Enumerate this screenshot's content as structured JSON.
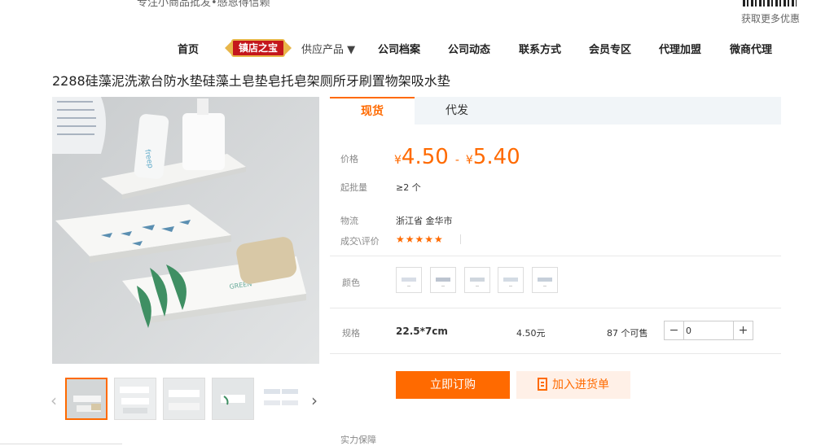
{
  "header": {
    "slogan": "专注小商品批发•感恩得信赖",
    "qr_text": "获取更多优惠"
  },
  "nav": {
    "home": "首页",
    "badge": "镇店之宝",
    "supply": "供应产品 ▼",
    "profile": "公司档案",
    "news": "公司动态",
    "contact": "联系方式",
    "member": "会员专区",
    "agent": "代理加盟",
    "micro": "微商代理"
  },
  "product": {
    "title": "2288硅藻泥洗漱台防水垫硅藻土皂垫皂托皂架厕所牙刷置物架吸水垫"
  },
  "tabs": [
    "现货",
    "代发"
  ],
  "price": {
    "label": "价格",
    "currency": "¥",
    "min": "4.50",
    "sep": "-",
    "max": "5.40"
  },
  "moq": {
    "label": "起批量",
    "value": "≥2 个"
  },
  "logistics": {
    "label": "物流",
    "value": "浙江省 金华市"
  },
  "reviews": {
    "label": "成交\\评价",
    "stars": "★★★★★",
    "rating": 5
  },
  "color": {
    "label": "颜色",
    "swatch_count": 5
  },
  "spec": {
    "label": "规格",
    "size": "22.5*7cm",
    "price": "4.50元",
    "stock": "87 个可售",
    "qty": "0",
    "minus": "−",
    "plus": "+"
  },
  "actions": {
    "buy": "立即订购",
    "cart": "加入进货单"
  },
  "guarantee": {
    "label": "实力保障"
  },
  "icons": {
    "dropdown": "chevron-down-icon",
    "prev": "chevron-left-icon",
    "next": "chevron-right-icon",
    "cart": "purchase-list-icon",
    "qr": "qr-code-icon"
  },
  "colors": {
    "accent": "#ff6a00",
    "badge_red": "#c4161c",
    "badge_gold": "#e8b64a"
  }
}
